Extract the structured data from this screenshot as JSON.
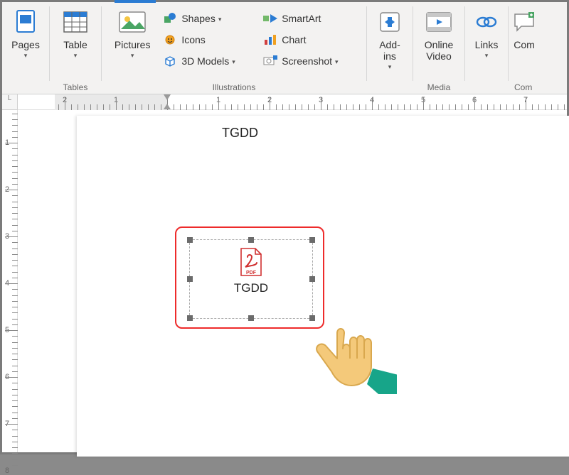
{
  "ribbon": {
    "pages": {
      "label": "Pages"
    },
    "table": {
      "label": "Table",
      "group": "Tables"
    },
    "illustrations": {
      "group": "Illustrations",
      "pictures": "Pictures",
      "shapes": "Shapes",
      "icons": "Icons",
      "models": "3D Models",
      "smartart": "SmartArt",
      "chart": "Chart",
      "screenshot": "Screenshot"
    },
    "addins": {
      "label": "Add-\nins"
    },
    "media": {
      "group": "Media",
      "video": "Online\nVideo"
    },
    "links": {
      "label": "Links"
    },
    "comments": {
      "label": "Com",
      "group": "Com"
    }
  },
  "ruler_corner": "L",
  "document": {
    "header_text": "TGDD",
    "object": {
      "type": "PDF",
      "label": "TGDD",
      "badge": "PDF"
    }
  }
}
